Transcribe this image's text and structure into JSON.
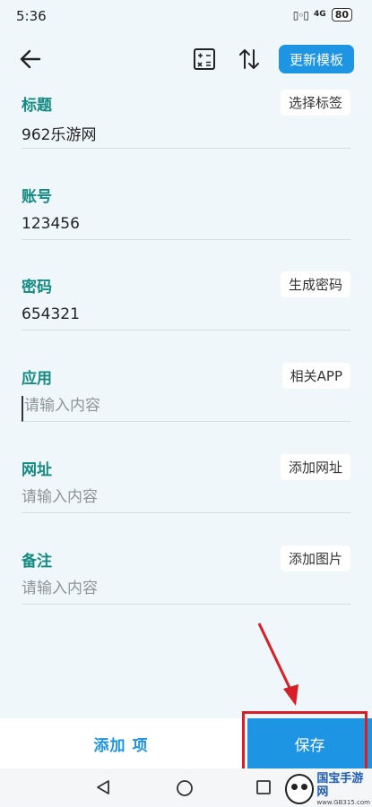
{
  "status_bar": {
    "time": "5:36",
    "network": "4G",
    "battery": "80"
  },
  "toolbar": {
    "template_label": "更新模板"
  },
  "fields": [
    {
      "label": "标题",
      "value": "962乐游网",
      "placeholder": "",
      "action": "选择标签"
    },
    {
      "label": "账号",
      "value": "123456",
      "placeholder": "",
      "action": ""
    },
    {
      "label": "密码",
      "value": "654321",
      "placeholder": "",
      "action": "生成密码"
    },
    {
      "label": "应用",
      "value": "",
      "placeholder": "请输入内容",
      "action": "相关APP"
    },
    {
      "label": "网址",
      "value": "",
      "placeholder": "请输入内容",
      "action": "添加网址"
    },
    {
      "label": "备注",
      "value": "",
      "placeholder": "请输入内容",
      "action": "添加图片"
    }
  ],
  "bottom_bar": {
    "add_item_label": "添加 项",
    "save_label": "保存"
  },
  "watermark": {
    "title": "国宝手游网",
    "url": "www.GB315.com"
  },
  "colors": {
    "accent": "#1d95e3",
    "label": "#148b82",
    "highlight": "#d61f26",
    "background": "#f0f7fb"
  },
  "icons": [
    "back-arrow-icon",
    "calculator-icon",
    "sort-icon",
    "nav-back-icon",
    "nav-home-icon",
    "nav-recent-icon"
  ]
}
